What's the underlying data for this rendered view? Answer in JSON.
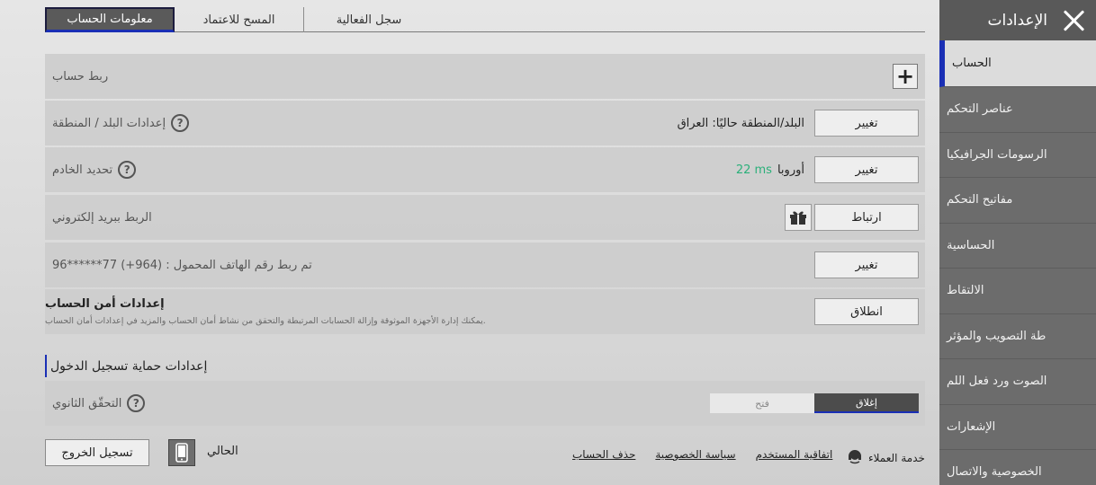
{
  "sidebar": {
    "title": "الإعدادات",
    "items": [
      {
        "label": "الحساب"
      },
      {
        "label": "عناصر التحكم"
      },
      {
        "label": "الرسومات الجرافيكيا"
      },
      {
        "label": "مفاتيح التحكم"
      },
      {
        "label": "الحساسية"
      },
      {
        "label": "الالتقاط"
      },
      {
        "label": "طة التصويب والمؤثر"
      },
      {
        "label": "الصوت ورد فعل اللم"
      },
      {
        "label": "الإشعارات"
      },
      {
        "label": "الخصوصية والاتصال"
      }
    ]
  },
  "tabs": [
    "معلومات الحساب",
    "المسح للاعتماد",
    "سجل الفعالية"
  ],
  "rows": {
    "link_account": {
      "label": "ربط حساب"
    },
    "region": {
      "label": "إعدادات البلد / المنطقة",
      "current": "البلد/المنطقة حاليًا: العراق",
      "button": "تغيير"
    },
    "server": {
      "label": "تحديد الخادم",
      "server_name": "أوروبا",
      "ping": "22 ms",
      "button": "تغيير"
    },
    "email": {
      "label": "الربط ببريد إلكتروني",
      "button": "ارتباط"
    },
    "phone": {
      "label": "تم ربط رقم الهاتف المحمول : (964+) 77******96",
      "button": "تغيير"
    },
    "security": {
      "title": "إعدادات أمن الحساب",
      "desc": "يمكنك إدارة الأجهزة الموثوقة وإزالة الحسابات المرتبطة والتحقق من نشاط أمان الحساب والمزيد في إعدادات أمان الحساب.",
      "button": "انطلاق"
    }
  },
  "login_protection": {
    "heading": "إعدادات حماية تسجيل الدخول",
    "two_factor_label": "التحقّق الثانوي",
    "toggle_on": "فتح",
    "toggle_off": "إغلاق",
    "selected": "إغلاق"
  },
  "footer": {
    "logout": "تسجيل الخروج",
    "current": "الحالي",
    "links": [
      "حذف الحساب",
      "سياسة الخصوصية",
      "اتفاقية المستخدم"
    ],
    "support": "خدمة العملاء"
  },
  "colors": {
    "accent": "#1a2fb5",
    "ping": "#2bb07a"
  }
}
